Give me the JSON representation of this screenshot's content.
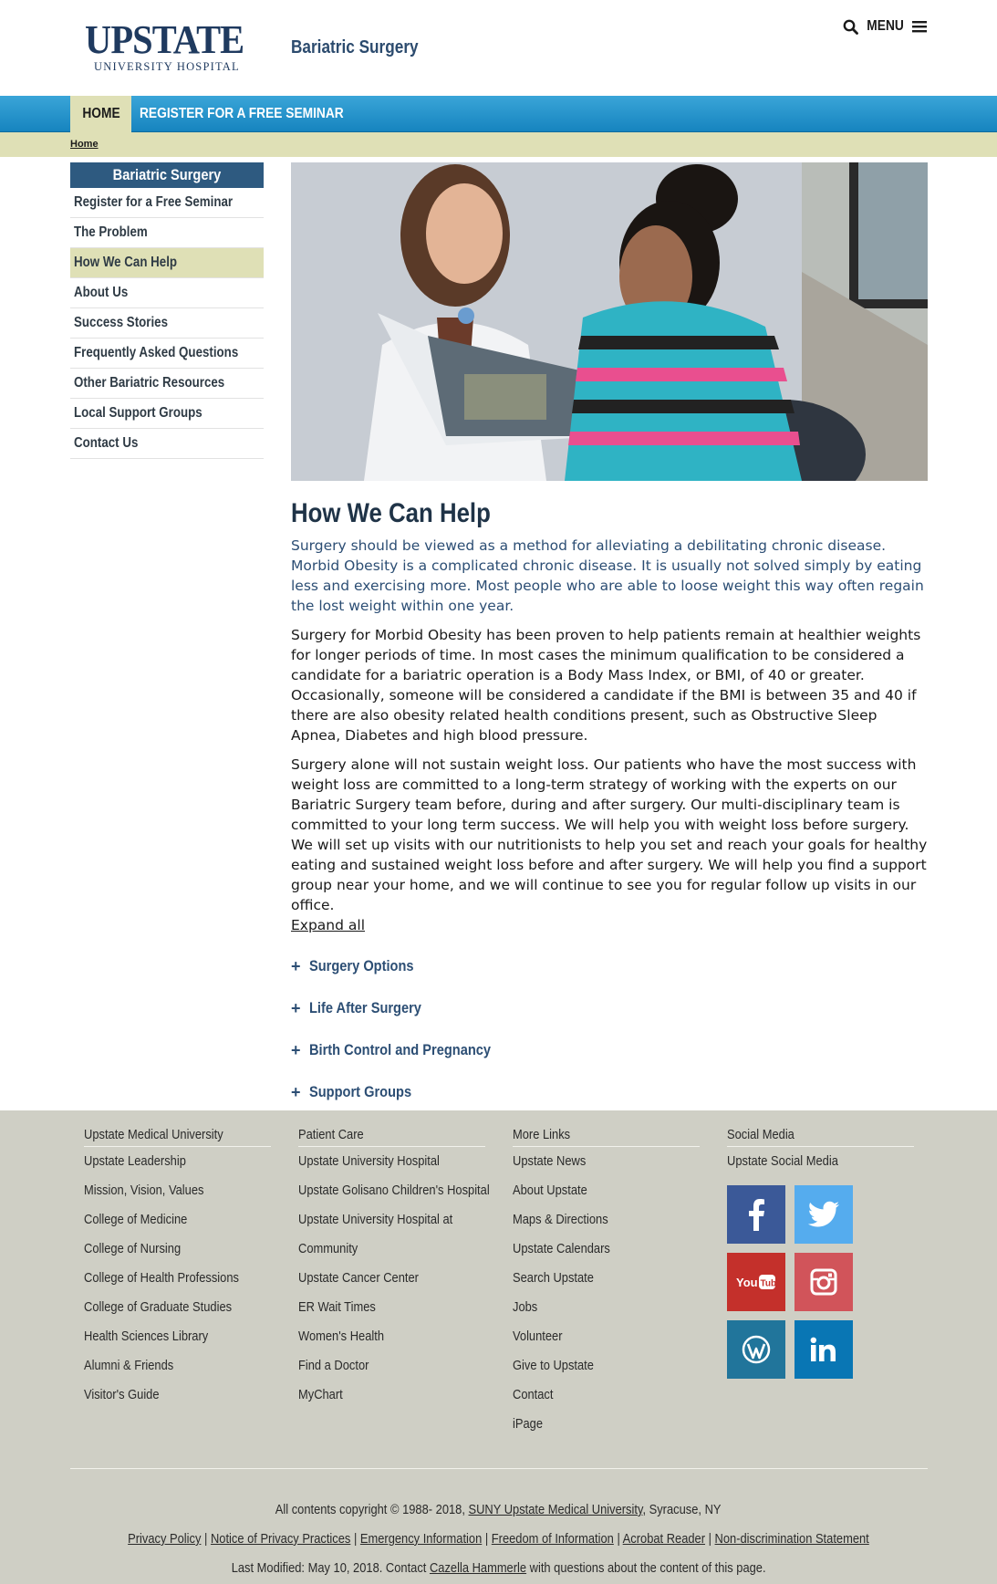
{
  "header": {
    "logo_main": "UPSTATE",
    "logo_sub": "UNIVERSITY HOSPITAL",
    "site_title": "Bariatric Surgery",
    "menu_label": "MENU"
  },
  "nav": {
    "home": "HOME",
    "register": "REGISTER FOR A FREE SEMINAR",
    "breadcrumb": "Home"
  },
  "sidebar": {
    "heading": "Bariatric Surgery",
    "items": [
      {
        "label": "Register for a Free Seminar"
      },
      {
        "label": "The Problem"
      },
      {
        "label": "How We Can Help"
      },
      {
        "label": "About Us"
      },
      {
        "label": "Success Stories"
      },
      {
        "label": "Frequently Asked Questions"
      },
      {
        "label": "Other Bariatric Resources"
      },
      {
        "label": "Local Support Groups"
      },
      {
        "label": "Contact Us"
      }
    ],
    "active_index": 2
  },
  "main": {
    "title": "How We Can Help",
    "lead": "Surgery should be viewed as a method for alleviating a debilitating chronic disease. Morbid Obesity is a complicated chronic disease. It is usually not solved simply by eating less and exercising more. Most people who are able to loose weight this way often regain the lost weight within one year.",
    "para1": "Surgery for Morbid Obesity has been proven to help patients remain at healthier weights for longer periods of time. In most cases the minimum qualification to be considered a candidate for a bariatric operation is a Body Mass Index, or BMI, of 40 or greater. Occasionally, someone will be considered  a candidate if the BMI is between 35 and 40 if there are also obesity related health conditions present, such as Obstructive Sleep Apnea, Diabetes and high blood pressure.",
    "para2": "Surgery alone will not sustain weight loss. Our patients who have the most success with weight loss are committed to a long-term strategy of working with the experts on our Bariatric Surgery team before, during and after surgery.  Our multi-disciplinary team is committed to your long term success.  We will help you with weight loss before surgery.  We will set up visits with our nutritionists to help you set and reach your goals for healthy eating and sustained weight loss before and after surgery.  We will help you find a support group near your home, and we will continue to see you for regular follow up visits in our office.",
    "expand_all": "Expand all",
    "accordion": [
      {
        "label": "Surgery Options"
      },
      {
        "label": "Life After Surgery"
      },
      {
        "label": "Birth Control and Pregnancy"
      },
      {
        "label": "Support Groups"
      }
    ]
  },
  "footer": {
    "col1": {
      "heading": "Upstate Medical University",
      "links": [
        "Upstate Leadership",
        "Mission, Vision, Values",
        "College of Medicine",
        "College of Nursing",
        "College of Health Professions",
        "College of Graduate Studies",
        "Health Sciences Library",
        "Alumni & Friends",
        "Visitor's Guide"
      ]
    },
    "col2": {
      "heading": "Patient Care",
      "links": [
        "Upstate University Hospital",
        "Upstate Golisano Children's Hospital",
        "Upstate University Hospital at",
        "Community",
        "Upstate Cancer Center",
        "ER Wait Times",
        "Women's Health",
        "Find a Doctor",
        "MyChart"
      ]
    },
    "col3": {
      "heading": "More Links",
      "links": [
        "Upstate News",
        "About Upstate",
        "Maps & Directions",
        "Upstate Calendars",
        "Search Upstate",
        "Jobs",
        "Volunteer",
        "Give to Upstate",
        "Contact",
        "iPage"
      ]
    },
    "col4": {
      "heading": "Social Media",
      "link": "Upstate Social Media",
      "socials": [
        {
          "icon": "facebook-icon",
          "color": "#3b5998"
        },
        {
          "icon": "twitter-icon",
          "color": "#55acee"
        },
        {
          "icon": "youtube-icon",
          "color": "#c4302b"
        },
        {
          "icon": "instagram-icon",
          "color": "#d1545a"
        },
        {
          "icon": "wordpress-icon",
          "color": "#21759b"
        },
        {
          "icon": "linkedin-icon",
          "color": "#0976b4"
        }
      ]
    },
    "copyright_pre": "All contents copyright © 1988- 2018, ",
    "copyright_link": "SUNY Upstate Medical University",
    "copyright_post": ", Syracuse, NY",
    "legal_links": [
      "Privacy Policy",
      "Notice of Privacy Practices",
      "Emergency Information",
      "Freedom of Information",
      "Acrobat Reader",
      "Non-discrimination Statement"
    ],
    "modified_pre": "Last Modified: May 10, 2018. Contact ",
    "modified_link": "Cazella Hammerle",
    "modified_post": " with questions about the content of this page."
  }
}
